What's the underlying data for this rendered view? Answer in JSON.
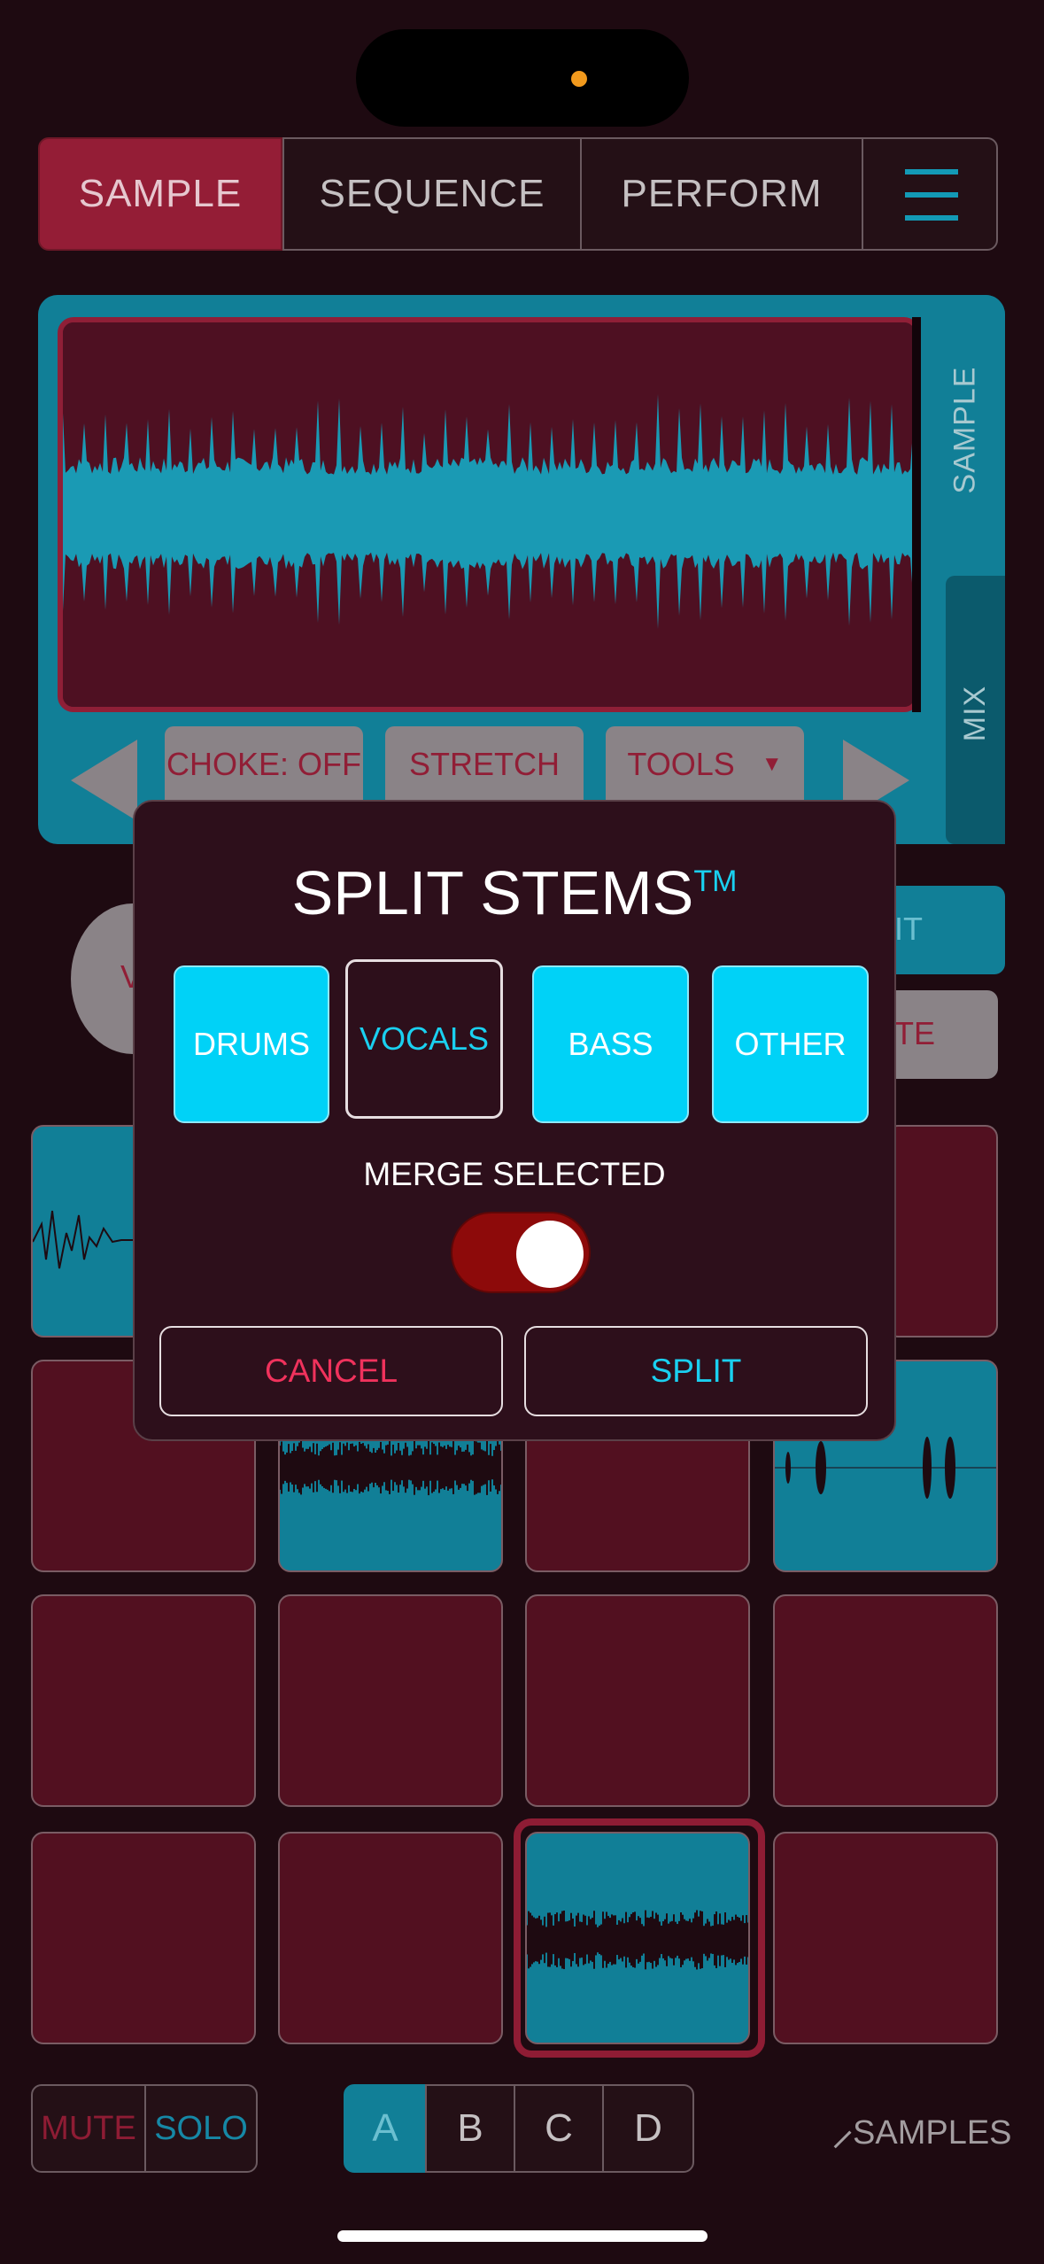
{
  "status": {},
  "tabs": [
    {
      "label": "SAMPLE",
      "active": true
    },
    {
      "label": "SEQUENCE",
      "active": false
    },
    {
      "label": "PERFORM",
      "active": false
    }
  ],
  "side_tabs": {
    "sample": "SAMPLE",
    "mix": "MIX"
  },
  "controls": {
    "choke": "CHOKE: OFF",
    "stretch": "STRETCH",
    "tools": "TOOLS"
  },
  "modal": {
    "title": "SPLIT STEMS",
    "title_mark": "TM",
    "stems": [
      {
        "label": "DRUMS",
        "selected": true
      },
      {
        "label": "VOCALS",
        "selected": false
      },
      {
        "label": "BASS",
        "selected": true
      },
      {
        "label": "OTHER",
        "selected": true
      }
    ],
    "merge_label": "MERGE SELECTED",
    "merge_on": true,
    "cancel": "CANCEL",
    "split": "SPLIT"
  },
  "partially_hidden": {
    "right_btn_1": "IT",
    "right_btn_2": "TE",
    "left_btn": "V"
  },
  "bottom": {
    "mute": "MUTE",
    "solo": "SOLO",
    "banks": [
      "A",
      "B",
      "C",
      "D"
    ],
    "active_bank": "A",
    "samples": "SAMPLES"
  },
  "colors": {
    "accent": "#00d2f7",
    "brand_red": "#941d36",
    "teal": "#117f97",
    "pad_red": "#521020"
  }
}
